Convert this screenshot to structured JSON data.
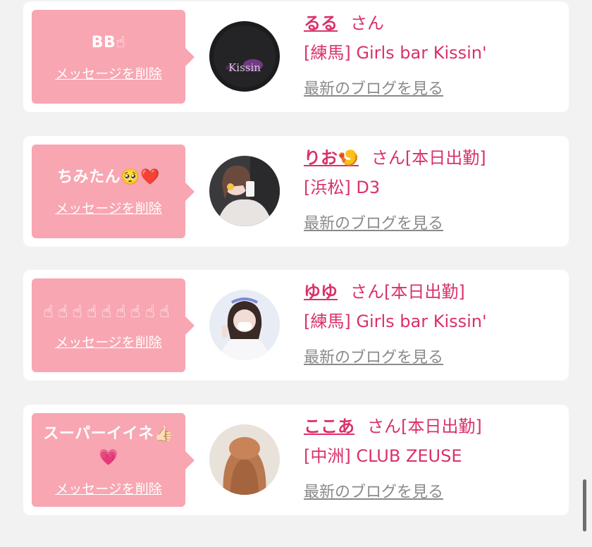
{
  "cards": [
    {
      "message": "BB☝",
      "delete_label": "メッセージを削除",
      "name": "るる",
      "honorific": "さん",
      "shop": "[練馬] Girls bar Kissin'",
      "blog_link": "最新のブログを見る",
      "avatar_text": "Kissin"
    },
    {
      "message": "ちみたん🥺❤️",
      "delete_label": "メッセージを削除",
      "name": "りお🍤",
      "honorific": "さん[本日出勤]",
      "shop": "[浜松] D3",
      "blog_link": "最新のブログを見る"
    },
    {
      "message": "☝☝☝☝☝☝☝☝☝",
      "delete_label": "メッセージを削除",
      "name": "ゆゆ",
      "honorific": "さん[本日出勤]",
      "shop": "[練馬] Girls bar Kissin'",
      "blog_link": "最新のブログを見る"
    },
    {
      "message": "スーパーイイネ👍🏻💗",
      "delete_label": "メッセージを削除",
      "name": "ここあ",
      "honorific": "さん[本日出勤]",
      "shop": "[中洲] CLUB ZEUSE",
      "blog_link": "最新のブログを見る"
    }
  ],
  "colors": {
    "bubble": "#f8a6b2",
    "accent": "#d9316a",
    "muted": "#8a8a8a",
    "background": "#f2f2f2"
  }
}
